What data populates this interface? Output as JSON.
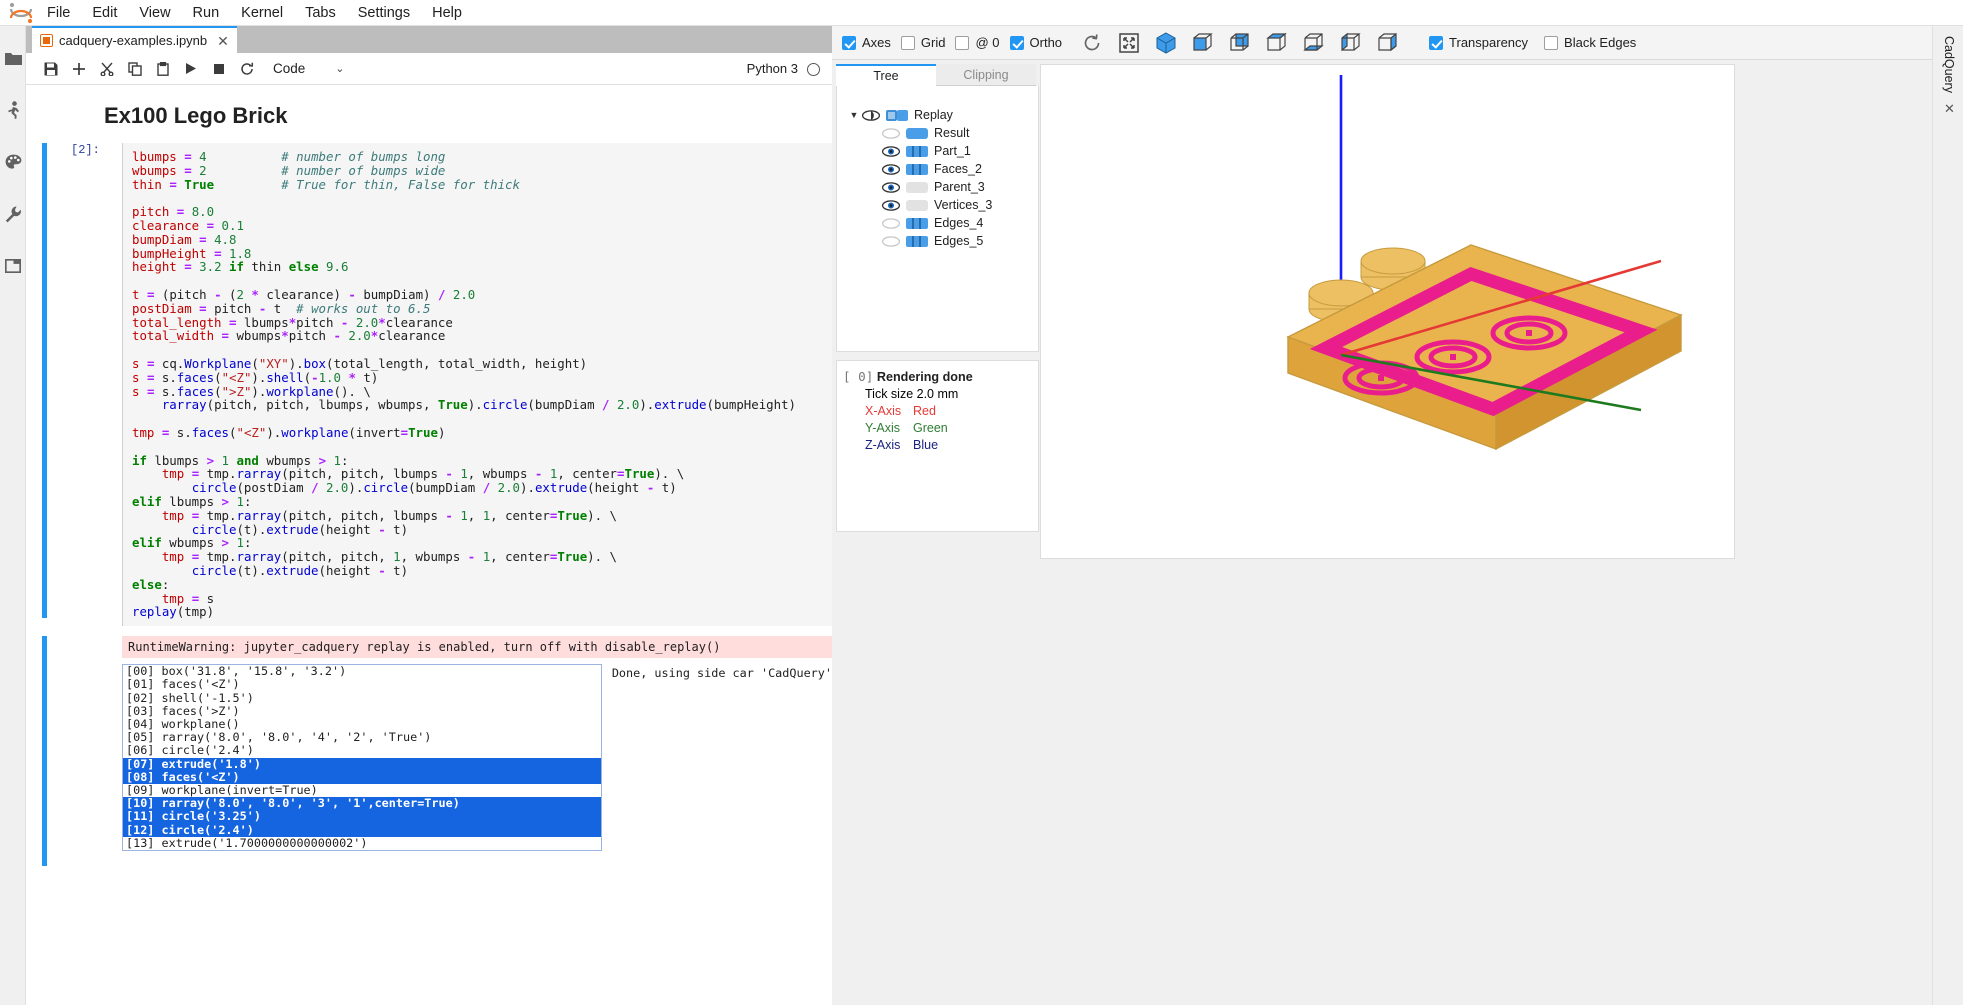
{
  "menu": {
    "items": [
      "File",
      "Edit",
      "View",
      "Run",
      "Kernel",
      "Tabs",
      "Settings",
      "Help"
    ]
  },
  "left_sidebar": {
    "icons": [
      "folder-icon",
      "running-icon",
      "palette-icon",
      "wrench-icon",
      "open-tabs-icon"
    ]
  },
  "notebook": {
    "tab_name": "cadquery-examples.ipynb",
    "tab_close": "✕",
    "toolbar": {
      "save": "save-icon",
      "add": "+",
      "cut": "cut-icon",
      "copy": "copy-icon",
      "paste": "paste-icon",
      "run": "▶",
      "stop": "■",
      "restart": "↻",
      "cell_type": "Code",
      "caret": "⌄"
    },
    "kernel_name": "Python 3",
    "heading": "Ex100 Lego Brick",
    "prompt": "[2]:",
    "code_lines": [
      "lbumps = 4          # number of bumps long",
      "wbumps = 2          # number of bumps wide",
      "thin = True         # True for thin, False for thick",
      "",
      "pitch = 8.0",
      "clearance = 0.1",
      "bumpDiam = 4.8",
      "bumpHeight = 1.8",
      "height = 3.2 if thin else 9.6",
      "",
      "t = (pitch - (2 * clearance) - bumpDiam) / 2.0",
      "postDiam = pitch - t  # works out to 6.5",
      "total_length = lbumps*pitch - 2.0*clearance",
      "total_width = wbumps*pitch - 2.0*clearance",
      "",
      "s = cq.Workplane(\"XY\").box(total_length, total_width, height)",
      "s = s.faces(\"<Z\").shell(-1.0 * t)",
      "s = s.faces(\">Z\").workplane(). \\",
      "    rarray(pitch, pitch, lbumps, wbumps, True).circle(bumpDiam / 2.0).extrude(bumpHeight)",
      "",
      "tmp = s.faces(\"<Z\").workplane(invert=True)",
      "",
      "if lbumps > 1 and wbumps > 1:",
      "    tmp = tmp.rarray(pitch, pitch, lbumps - 1, wbumps - 1, center=True). \\",
      "        circle(postDiam / 2.0).circle(bumpDiam / 2.0).extrude(height - t)",
      "elif lbumps > 1:",
      "    tmp = tmp.rarray(pitch, pitch, lbumps - 1, 1, center=True). \\",
      "        circle(t).extrude(height - t)",
      "elif wbumps > 1:",
      "    tmp = tmp.rarray(pitch, pitch, 1, wbumps - 1, center=True). \\",
      "        circle(t).extrude(height - t)",
      "else:",
      "    tmp = s",
      "replay(tmp)"
    ],
    "warning": "RuntimeWarning: jupyter_cadquery replay is enabled, turn off with disable_replay()",
    "replay_lines": [
      {
        "text": "[00] box('31.8', '15.8', '3.2')",
        "selected": false
      },
      {
        "text": "[01] faces('<Z')",
        "selected": false
      },
      {
        "text": "[02] shell('-1.5')",
        "selected": false
      },
      {
        "text": "[03] faces('>Z')",
        "selected": false
      },
      {
        "text": "[04] workplane()",
        "selected": false
      },
      {
        "text": "[05] rarray('8.0', '8.0', '4', '2', 'True')",
        "selected": false
      },
      {
        "text": "[06] circle('2.4')",
        "selected": false
      },
      {
        "text": "[07] extrude('1.8')",
        "selected": true
      },
      {
        "text": "[08] faces('<Z')",
        "selected": true
      },
      {
        "text": "[09] workplane(invert=True)",
        "selected": false
      },
      {
        "text": "[10] rarray('8.0', '8.0', '3', '1',center=True)",
        "selected": true
      },
      {
        "text": "[11] circle('3.25')",
        "selected": true
      },
      {
        "text": "[12] circle('2.4')",
        "selected": true
      },
      {
        "text": "[13] extrude('1.7000000000000002')",
        "selected": false
      }
    ],
    "done_output": "Done, using side car 'CadQuery'"
  },
  "cadquery": {
    "toolbar": {
      "checkboxes": [
        {
          "label": "Axes",
          "checked": true
        },
        {
          "label": "Grid",
          "checked": false
        },
        {
          "label": "@ 0",
          "checked": false
        },
        {
          "label": "Ortho",
          "checked": true
        }
      ],
      "right_checkboxes": [
        {
          "label": "Transparency",
          "checked": true
        },
        {
          "label": "Black Edges",
          "checked": false
        }
      ],
      "buttons": [
        "reset-view-icon",
        "fit-view-icon",
        "iso-view-icon",
        "front-view-icon",
        "rear-view-icon",
        "top-view-icon",
        "bottom-view-icon",
        "left-view-icon",
        "right-view-icon"
      ]
    },
    "tabs": [
      {
        "label": "Tree",
        "active": true
      },
      {
        "label": "Clipping",
        "active": false
      }
    ],
    "tree": [
      {
        "label": "Replay",
        "indent": 0,
        "caret": "▼",
        "eye": "half",
        "swatch": "mesh-half"
      },
      {
        "label": "Result",
        "indent": 1,
        "caret": "",
        "eye": "off",
        "swatch": "solid"
      },
      {
        "label": "Part_1",
        "indent": 1,
        "caret": "",
        "eye": "on",
        "swatch": "mesh"
      },
      {
        "label": "Faces_2",
        "indent": 1,
        "caret": "",
        "eye": "on",
        "swatch": "mesh"
      },
      {
        "label": "Parent_3",
        "indent": 1,
        "caret": "",
        "eye": "on",
        "swatch": "grey"
      },
      {
        "label": "Vertices_3",
        "indent": 1,
        "caret": "",
        "eye": "on",
        "swatch": "grey"
      },
      {
        "label": "Edges_4",
        "indent": 1,
        "caret": "",
        "eye": "dim",
        "swatch": "mesh"
      },
      {
        "label": "Edges_5",
        "indent": 1,
        "caret": "",
        "eye": "dim",
        "swatch": "mesh"
      }
    ],
    "status": {
      "index": "[ 0]",
      "title": "Rendering done",
      "tick_size_label": "Tick size 2.0 mm",
      "axes": [
        {
          "name": "X-Axis",
          "color_name": "Red",
          "hex": "#e53935"
        },
        {
          "name": "Y-Axis",
          "color_name": "Green",
          "hex": "#2e7d32"
        },
        {
          "name": "Z-Axis",
          "color_name": "Blue",
          "hex": "#1a237e"
        }
      ]
    },
    "model": {
      "brick_color": "#e8b04b",
      "brick_top_color": "#f0c060",
      "highlight_color": "#e91e8c",
      "x_axis_color": "#e53935",
      "y_axis_color": "#2e7d32",
      "z_axis_color": "#1a1aff"
    }
  },
  "sidecar": {
    "label": "CadQuery",
    "close": "✕"
  }
}
